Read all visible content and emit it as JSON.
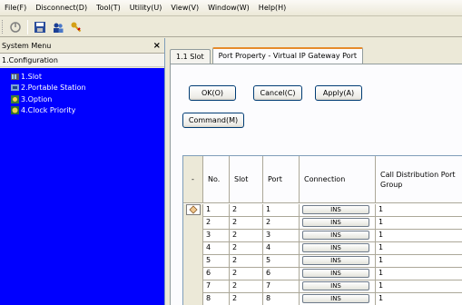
{
  "menu": [
    "File(F)",
    "Disconnect(D)",
    "Tool(T)",
    "Utility(U)",
    "View(V)",
    "Window(W)",
    "Help(H)"
  ],
  "toolbar": {
    "icons": [
      "connect-icon",
      "save-icon",
      "users-icon",
      "key-icon"
    ]
  },
  "left_pane": {
    "title": "System Menu",
    "close_label": "×",
    "section": "1.Configuration",
    "items": [
      {
        "label": "1.Slot",
        "icon": "slot-icon"
      },
      {
        "label": "2.Portable Station",
        "icon": "portable-station-icon"
      },
      {
        "label": "3.Option",
        "icon": "option-icon"
      },
      {
        "label": "4.Clock Priority",
        "icon": "clock-priority-icon"
      }
    ]
  },
  "tabs": [
    {
      "label": "1.1 Slot"
    },
    {
      "label": "Port Property - Virtual IP Gateway Port"
    }
  ],
  "buttons": {
    "ok": "OK(O)",
    "cancel": "Cancel(C)",
    "apply": "Apply(A)",
    "command": "Command(M)"
  },
  "grid": {
    "corner": "-",
    "headers": [
      "No.",
      "Slot",
      "Port",
      "Connection",
      "Call Distribution Port Group"
    ],
    "rows": [
      {
        "no": "1",
        "slot": "2",
        "port": "1",
        "connection": "INS",
        "group": "1"
      },
      {
        "no": "2",
        "slot": "2",
        "port": "2",
        "connection": "INS",
        "group": "1"
      },
      {
        "no": "3",
        "slot": "2",
        "port": "3",
        "connection": "INS",
        "group": "1"
      },
      {
        "no": "4",
        "slot": "2",
        "port": "4",
        "connection": "INS",
        "group": "1"
      },
      {
        "no": "5",
        "slot": "2",
        "port": "5",
        "connection": "INS",
        "group": "1"
      },
      {
        "no": "6",
        "slot": "2",
        "port": "6",
        "connection": "INS",
        "group": "1"
      },
      {
        "no": "7",
        "slot": "2",
        "port": "7",
        "connection": "INS",
        "group": "1"
      },
      {
        "no": "8",
        "slot": "2",
        "port": "8",
        "connection": "INS",
        "group": "1"
      }
    ]
  },
  "colors": {
    "tree_bg": "#0000ff",
    "tab_accent": "#e68b2c"
  }
}
